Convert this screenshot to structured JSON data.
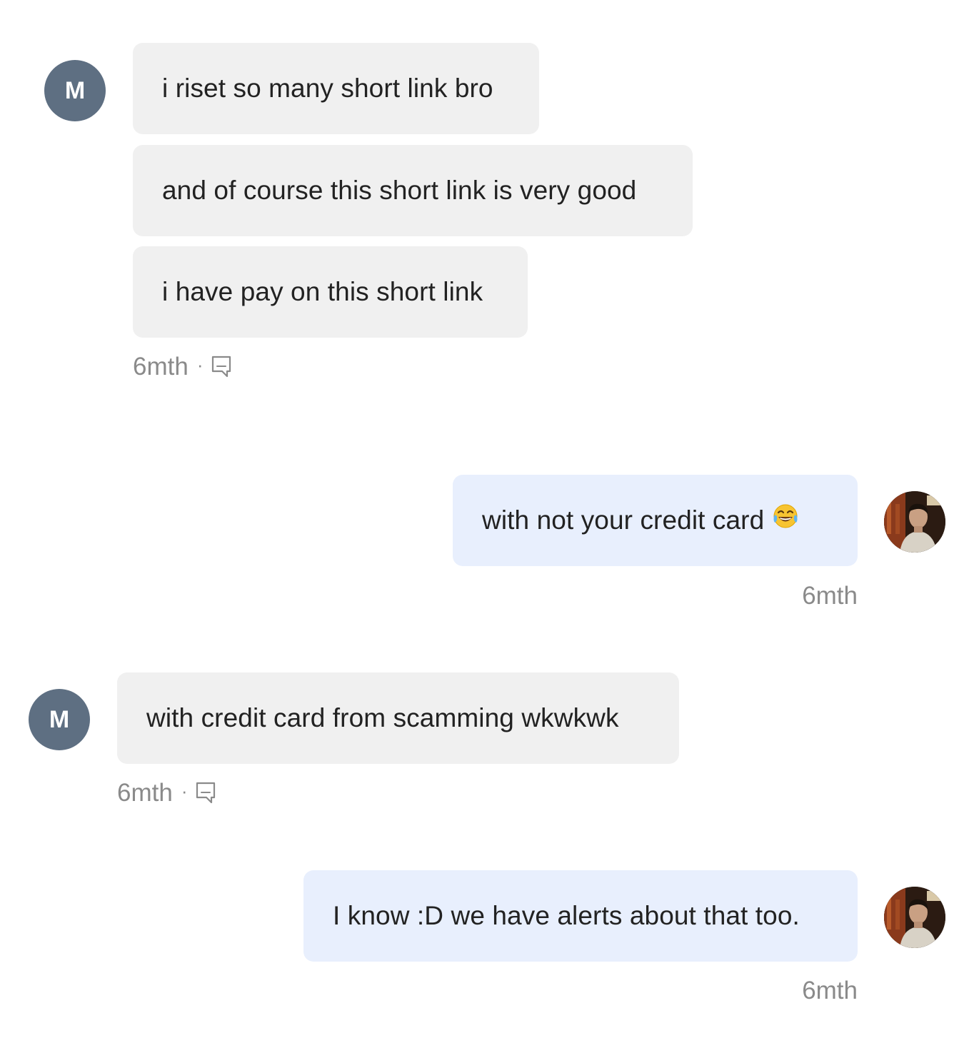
{
  "conversation": {
    "groups": [
      {
        "sender": "contact",
        "avatar_letter": "M",
        "messages": [
          "i riset so many short link bro",
          "and of course this short link is very good",
          "i have pay on this short link"
        ],
        "time": "6mth",
        "separator": "·",
        "meta_icon": "seen-icon"
      },
      {
        "sender": "me",
        "avatar_icon": "user-photo-avatar",
        "messages": [
          "with not your credit card"
        ],
        "emoji": "face-with-tears-of-joy",
        "time": "6mth"
      },
      {
        "sender": "contact",
        "avatar_letter": "M",
        "messages": [
          "with credit card from scamming wkwkwk"
        ],
        "time": "6mth",
        "separator": "·",
        "meta_icon": "seen-icon"
      },
      {
        "sender": "me",
        "avatar_icon": "user-photo-avatar",
        "messages": [
          "I know :D we have alerts about that too."
        ],
        "time": "6mth"
      }
    ]
  },
  "colors": {
    "incoming_bubble": "#f0f0f0",
    "outgoing_bubble": "#e8effd",
    "letter_avatar": "#5e6f82",
    "meta_text": "#8a8a8a"
  }
}
